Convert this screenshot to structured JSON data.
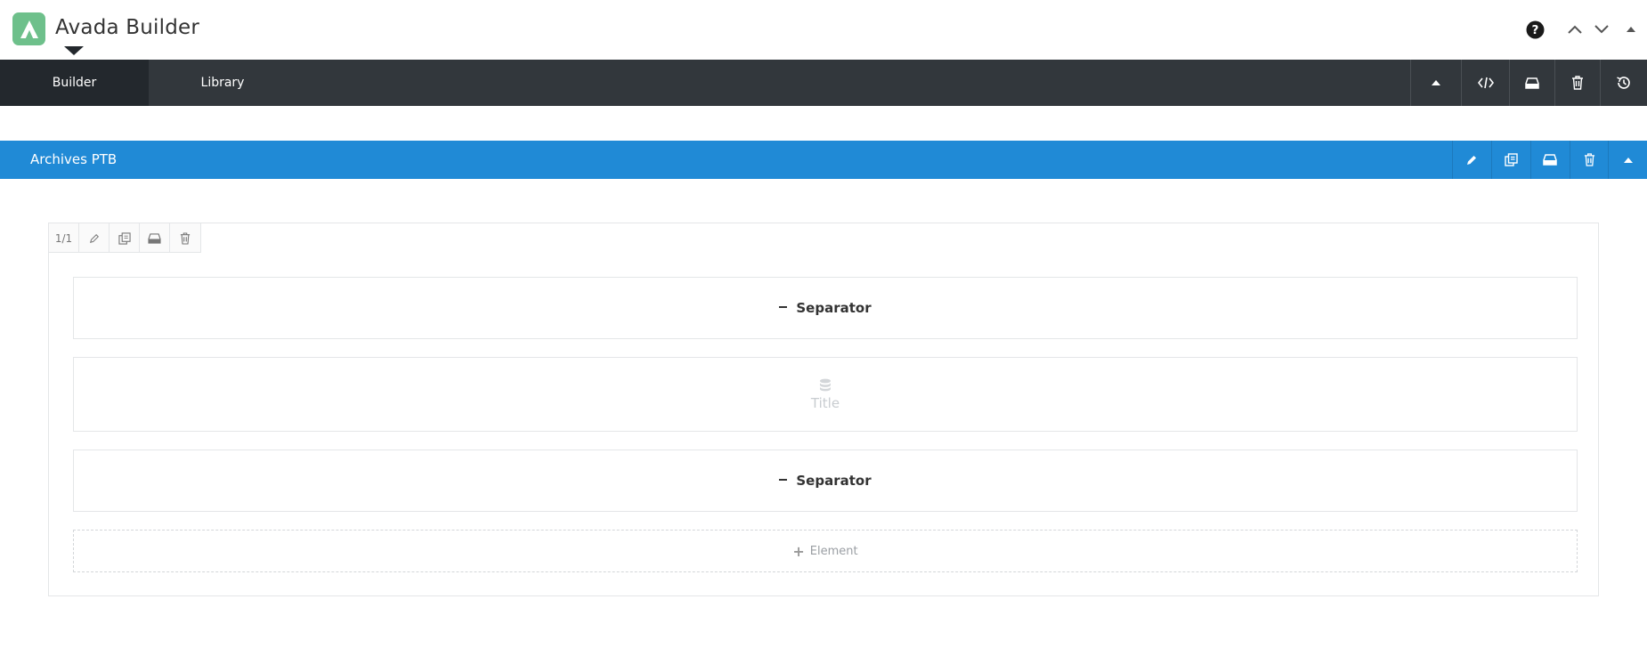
{
  "app": {
    "title": "Avada Builder",
    "brand_color": "#6ec08b"
  },
  "header_icons": [
    "help-icon",
    "chevron-up-icon",
    "chevron-down-icon",
    "triangle-up-icon"
  ],
  "tabs": [
    {
      "label": "Builder",
      "active": true
    },
    {
      "label": "Library",
      "active": false
    }
  ],
  "toolbar_icons": [
    "collapse-icon",
    "code-icon",
    "save-icon",
    "trash-icon",
    "history-icon"
  ],
  "container": {
    "title": "Archives PTB",
    "color": "#208ad6",
    "icons": [
      "pencil-icon",
      "clone-icon",
      "save-icon",
      "trash-icon",
      "collapse-icon"
    ]
  },
  "column": {
    "size_label": "1/1",
    "icons": [
      "pencil-icon",
      "clone-icon",
      "save-icon",
      "trash-icon"
    ]
  },
  "elements": [
    {
      "type": "separator",
      "label": "Separator"
    },
    {
      "type": "title",
      "label": "Title",
      "icon": "database-icon"
    },
    {
      "type": "separator",
      "label": "Separator"
    }
  ],
  "add_element_label": "Element"
}
